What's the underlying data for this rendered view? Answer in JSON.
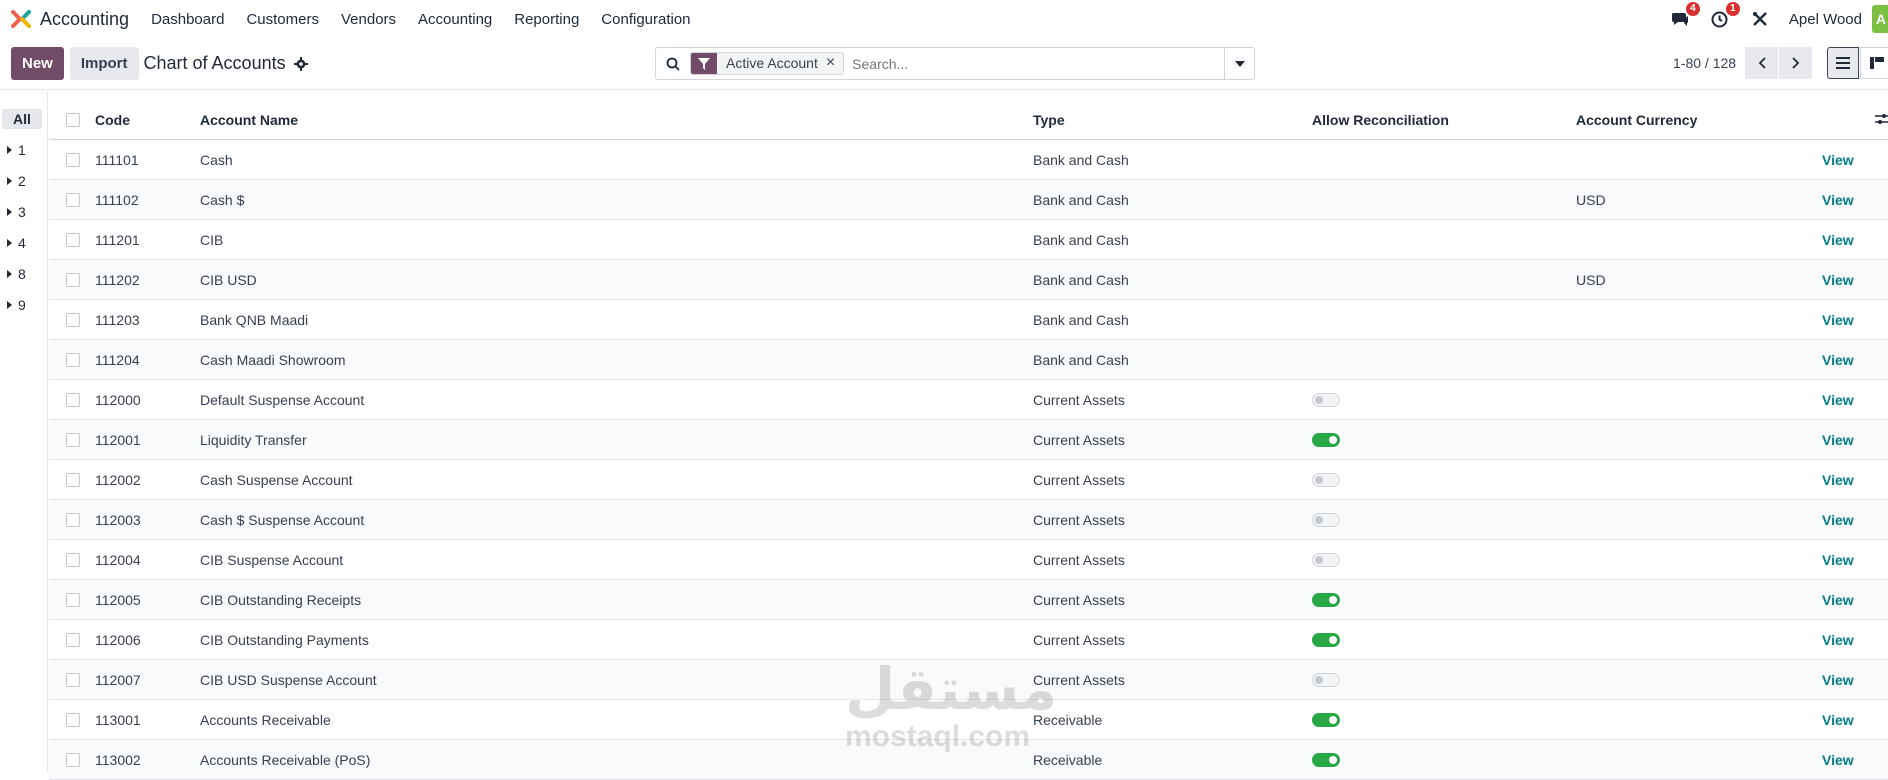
{
  "navbar": {
    "app_name": "Accounting",
    "menu": [
      "Dashboard",
      "Customers",
      "Vendors",
      "Accounting",
      "Reporting",
      "Configuration"
    ],
    "messages_badge": "4",
    "activities_badge": "1",
    "user_name": "Apel Wood",
    "avatar_letter": "A"
  },
  "control": {
    "new_label": "New",
    "import_label": "Import",
    "title": "Chart of Accounts",
    "facet_label": "Active Account",
    "search_placeholder": "Search...",
    "pager": "1-80 / 128"
  },
  "side_panel": {
    "all_label": "All",
    "groups": [
      "1",
      "2",
      "3",
      "4",
      "8",
      "9"
    ]
  },
  "table": {
    "headers": {
      "code": "Code",
      "name": "Account Name",
      "type": "Type",
      "reconcile": "Allow Reconciliation",
      "currency": "Account Currency"
    },
    "view_label": "View",
    "rows": [
      {
        "code": "111101",
        "name": "Cash",
        "type": "Bank and Cash",
        "reconcile": null,
        "currency": ""
      },
      {
        "code": "111102",
        "name": "Cash $",
        "type": "Bank and Cash",
        "reconcile": null,
        "currency": "USD"
      },
      {
        "code": "111201",
        "name": "CIB",
        "type": "Bank and Cash",
        "reconcile": null,
        "currency": ""
      },
      {
        "code": "111202",
        "name": "CIB USD",
        "type": "Bank and Cash",
        "reconcile": null,
        "currency": "USD"
      },
      {
        "code": "111203",
        "name": "Bank QNB Maadi",
        "type": "Bank and Cash",
        "reconcile": null,
        "currency": ""
      },
      {
        "code": "111204",
        "name": "Cash Maadi Showroom",
        "type": "Bank and Cash",
        "reconcile": null,
        "currency": ""
      },
      {
        "code": "112000",
        "name": "Default Suspense Account",
        "type": "Current Assets",
        "reconcile": false,
        "currency": ""
      },
      {
        "code": "112001",
        "name": "Liquidity Transfer",
        "type": "Current Assets",
        "reconcile": true,
        "currency": ""
      },
      {
        "code": "112002",
        "name": "Cash Suspense Account",
        "type": "Current Assets",
        "reconcile": false,
        "currency": ""
      },
      {
        "code": "112003",
        "name": "Cash $ Suspense Account",
        "type": "Current Assets",
        "reconcile": false,
        "currency": ""
      },
      {
        "code": "112004",
        "name": "CIB Suspense Account",
        "type": "Current Assets",
        "reconcile": false,
        "currency": ""
      },
      {
        "code": "112005",
        "name": "CIB Outstanding Receipts",
        "type": "Current Assets",
        "reconcile": true,
        "currency": ""
      },
      {
        "code": "112006",
        "name": "CIB Outstanding Payments",
        "type": "Current Assets",
        "reconcile": true,
        "currency": ""
      },
      {
        "code": "112007",
        "name": "CIB USD Suspense Account",
        "type": "Current Assets",
        "reconcile": false,
        "currency": ""
      },
      {
        "code": "113001",
        "name": "Accounts Receivable",
        "type": "Receivable",
        "reconcile": true,
        "currency": ""
      },
      {
        "code": "113002",
        "name": "Accounts Receivable (PoS)",
        "type": "Receivable",
        "reconcile": true,
        "currency": ""
      }
    ]
  },
  "watermark": {
    "arabic": "مستقل",
    "latin": "mostaql.com"
  },
  "colors": {
    "brand": "#714b67",
    "link": "#017e84",
    "toggle_on": "#28a745",
    "badge": "#d9302f"
  }
}
